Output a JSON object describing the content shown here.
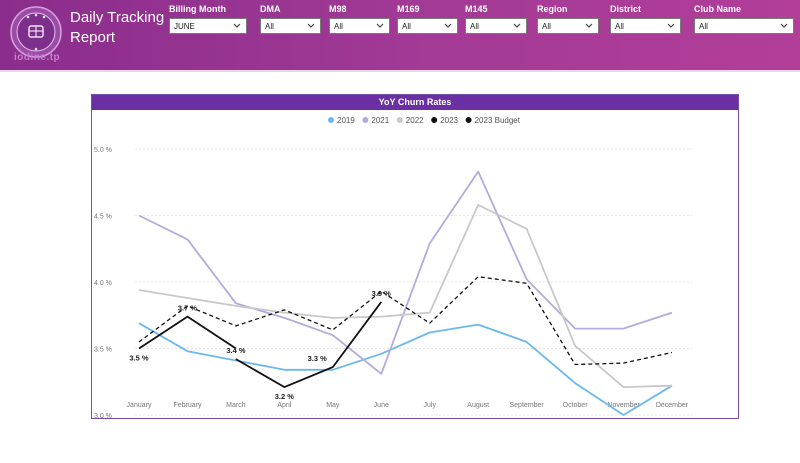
{
  "app": {
    "title": "Daily Tracking Report",
    "title_line1": "Daily Tracking",
    "title_line2": "Report",
    "logo_word": "iodine.tp"
  },
  "filters": [
    {
      "label": "Billing Month",
      "value": "JUNE"
    },
    {
      "label": "DMA",
      "value": "All"
    },
    {
      "label": "M98",
      "value": "All"
    },
    {
      "label": "M169",
      "value": "All"
    },
    {
      "label": "M145",
      "value": "All"
    },
    {
      "label": "Region",
      "value": "All"
    },
    {
      "label": "District",
      "value": "All"
    },
    {
      "label": "Club Name",
      "value": "All"
    }
  ],
  "colors": {
    "header": "#a33a96",
    "chart_title_bg": "#6a2fa2"
  },
  "chart_data": {
    "type": "line",
    "title": "YoY Churn Rates",
    "categories": [
      "January",
      "February",
      "March",
      "April",
      "May",
      "June",
      "July",
      "August",
      "September",
      "October",
      "November",
      "December"
    ],
    "y_ticks": [
      "5.0 %",
      "4.5 %",
      "4.0 %",
      "3.5 %",
      "3.0 %"
    ],
    "ylim": [
      3.0,
      5.0
    ],
    "legend_position": "top-center",
    "grid": true,
    "series": [
      {
        "name": "2019",
        "color": "#6cb8ee",
        "dashed": false,
        "values": [
          3.69,
          3.48,
          3.41,
          3.34,
          3.34,
          3.46,
          3.62,
          3.68,
          3.55,
          3.24,
          3.0,
          3.22
        ]
      },
      {
        "name": "2021",
        "color": "#b5a9de",
        "dashed": false,
        "values": [
          4.5,
          4.32,
          3.84,
          3.73,
          3.6,
          3.31,
          4.29,
          4.83,
          4.02,
          3.65,
          3.65,
          3.77
        ]
      },
      {
        "name": "2022",
        "color": "#c8c8c8",
        "dashed": false,
        "values": [
          3.94,
          3.88,
          3.82,
          3.77,
          3.73,
          3.74,
          3.77,
          4.58,
          4.4,
          3.52,
          3.21,
          3.22
        ]
      },
      {
        "name": "2023",
        "color": "#111111",
        "dashed": false,
        "values": [
          3.5,
          3.74,
          3.5,
          null,
          null,
          null,
          null,
          null,
          null,
          null,
          null,
          null
        ]
      },
      {
        "name": "2023",
        "color": "#111111",
        "dashed": false,
        "values": [
          null,
          null,
          3.42,
          3.21,
          3.36,
          3.85,
          null,
          null,
          null,
          null,
          null,
          null
        ]
      },
      {
        "name": "2023 Budget",
        "color": "#111111",
        "dashed": true,
        "values": [
          3.55,
          3.82,
          3.67,
          3.79,
          3.64,
          3.93,
          3.69,
          4.04,
          3.99,
          3.38,
          3.39,
          3.47
        ]
      }
    ],
    "legend": [
      {
        "name": "2019",
        "color": "#6cb8ee"
      },
      {
        "name": "2021",
        "color": "#b5a9de"
      },
      {
        "name": "2022",
        "color": "#c8c8c8"
      },
      {
        "name": "2023",
        "color": "#111111"
      },
      {
        "name": "2023 Budget",
        "color": "#111111"
      }
    ],
    "data_labels": [
      {
        "text": "3.5 %",
        "category": "January",
        "value": 3.5,
        "pos": "below"
      },
      {
        "text": "3.7 %",
        "category": "February",
        "value": 3.74,
        "pos": "above"
      },
      {
        "text": "3.4 %",
        "category": "March",
        "value": 3.42,
        "pos": "above"
      },
      {
        "text": "3.2 %",
        "category": "April",
        "value": 3.21,
        "pos": "below"
      },
      {
        "text": "3.3 %",
        "category": "May",
        "value": 3.36,
        "pos": "above-left"
      },
      {
        "text": "3.9 %",
        "category": "June",
        "value": 3.85,
        "pos": "above"
      }
    ]
  }
}
